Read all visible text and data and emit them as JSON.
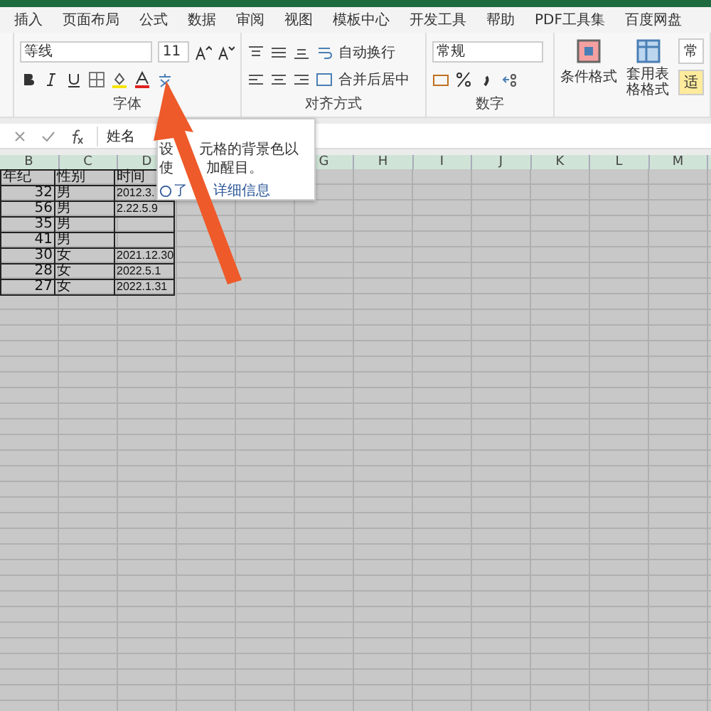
{
  "tabs": [
    {
      "label": "插入",
      "selected": false
    },
    {
      "label": "页面布局",
      "selected": false
    },
    {
      "label": "公式",
      "selected": false
    },
    {
      "label": "数据",
      "selected": false
    },
    {
      "label": "审阅",
      "selected": false
    },
    {
      "label": "视图",
      "selected": false
    },
    {
      "label": "模板中心",
      "selected": false
    },
    {
      "label": "开发工具",
      "selected": false
    },
    {
      "label": "帮助",
      "selected": false
    },
    {
      "label": "PDF工具集",
      "selected": false
    },
    {
      "label": "百度网盘",
      "selected": false
    }
  ],
  "font_group": {
    "label": "字体",
    "font_name": "等线",
    "font_size": "11"
  },
  "alignment_group": {
    "label": "对齐方式",
    "wrap_text": "自动换行",
    "merge_center": "合并后居中"
  },
  "number_group": {
    "label": "数字",
    "format": "常规"
  },
  "styles_group": {
    "conditional_format": "条件格式",
    "table_format": "套用表格格式",
    "style_normal": "常",
    "style_neutral": "适"
  },
  "formula_bar": {
    "value": "姓名"
  },
  "tooltip": {
    "lines": [
      [
        "设",
        "元格的背景色以"
      ],
      [
        "使",
        "加醒目。"
      ]
    ],
    "link": [
      "了",
      "详细信息"
    ]
  },
  "columns_left": [
    "B",
    "C",
    "D"
  ],
  "columns_right": [
    "G",
    "H",
    "I",
    "J",
    "K",
    "L",
    "M"
  ],
  "rows": [
    [
      "年纪",
      "性别",
      "时间"
    ],
    [
      "32",
      "男",
      "2012.3."
    ],
    [
      "56",
      "男",
      "2.22.5.9"
    ],
    [
      "35",
      "男",
      ""
    ],
    [
      "41",
      "男",
      ""
    ],
    [
      "30",
      "女",
      "2021.12.30"
    ],
    [
      "28",
      "女",
      "2022.5.1"
    ],
    [
      "27",
      "女",
      "2022.1.31"
    ]
  ]
}
